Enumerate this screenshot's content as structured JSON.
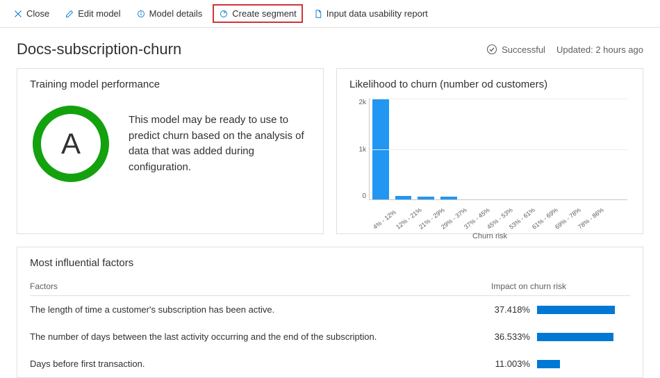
{
  "toolbar": {
    "close": "Close",
    "edit_model": "Edit model",
    "model_details": "Model details",
    "create_segment": "Create segment",
    "usability_report": "Input data usability report"
  },
  "header": {
    "title": "Docs-subscription-churn",
    "status": "Successful",
    "updated": "Updated: 2 hours ago"
  },
  "performance": {
    "title": "Training model performance",
    "grade": "A",
    "summary": "This model may be ready to use to predict churn based on the analysis of data that was added during configuration."
  },
  "chart_data": {
    "type": "bar",
    "title": "Likelihood to churn (number od customers)",
    "xlabel": "Churn risk",
    "ylabel": "",
    "ylim": [
      0,
      2000
    ],
    "y_ticks": [
      "2k",
      "1k",
      "0"
    ],
    "categories": [
      "4% - 12%",
      "12% - 21%",
      "21% - 29%",
      "29% - 37%",
      "37% - 45%",
      "45% - 53%",
      "53% - 61%",
      "61% - 69%",
      "69% - 78%",
      "78% - 86%"
    ],
    "values": [
      2050,
      70,
      55,
      60,
      0,
      0,
      0,
      0,
      0,
      0
    ]
  },
  "factors": {
    "title": "Most influential factors",
    "col_factor": "Factors",
    "col_impact": "Impact on churn risk",
    "rows": [
      {
        "label": "The length of time a customer's subscription has been active.",
        "impact_text": "37.418%",
        "impact_val": 37.418
      },
      {
        "label": "The number of days between the last activity occurring and the end of the subscription.",
        "impact_text": "36.533%",
        "impact_val": 36.533
      },
      {
        "label": "Days before first transaction.",
        "impact_text": "11.003%",
        "impact_val": 11.003
      }
    ]
  }
}
